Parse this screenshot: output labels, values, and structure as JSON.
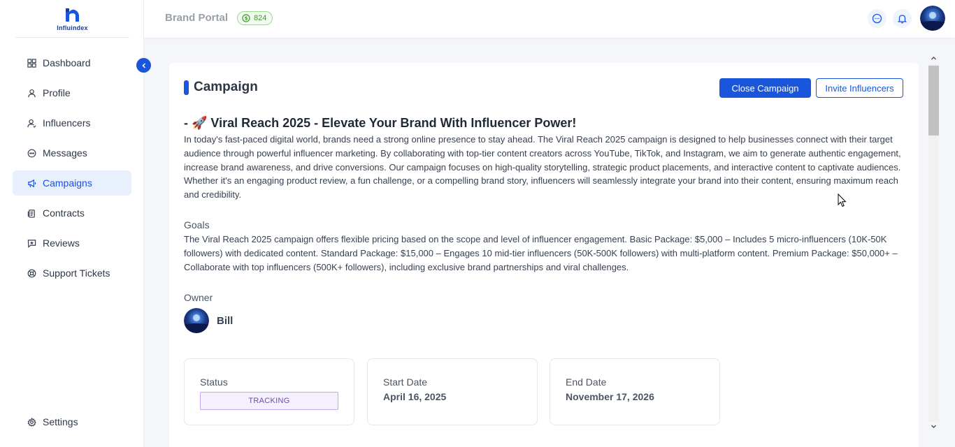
{
  "brand": {
    "logo_text": "Influindex"
  },
  "sidebar": {
    "items": [
      {
        "label": "Dashboard",
        "icon": "grid-icon",
        "active": false
      },
      {
        "label": "Profile",
        "icon": "user-icon",
        "active": false
      },
      {
        "label": "Influencers",
        "icon": "user-check-icon",
        "active": false
      },
      {
        "label": "Messages",
        "icon": "message-icon",
        "active": false
      },
      {
        "label": "Campaigns",
        "icon": "megaphone-icon",
        "active": true
      },
      {
        "label": "Contracts",
        "icon": "document-icon",
        "active": false
      },
      {
        "label": "Reviews",
        "icon": "review-icon",
        "active": false
      },
      {
        "label": "Support Tickets",
        "icon": "support-icon",
        "active": false
      }
    ],
    "settings_label": "Settings"
  },
  "header": {
    "title": "Brand Portal",
    "credits": "824"
  },
  "campaign": {
    "section_title": "Campaign",
    "close_button": "Close Campaign",
    "invite_button": "Invite Influencers",
    "heading": "- 🚀 Viral Reach 2025 - Elevate Your Brand With Influencer Power!",
    "description": "In today's fast-paced digital world, brands need a strong online presence to stay ahead. The Viral Reach 2025 campaign is designed to help businesses connect with their target audience through powerful influencer marketing. By collaborating with top-tier content creators across YouTube, TikTok, and Instagram, we aim to generate authentic engagement, increase brand awareness, and drive conversions. Our campaign focuses on high-quality storytelling, strategic product placements, and interactive content to captivate audiences. Whether it's an engaging product review, a fun challenge, or a compelling brand story, influencers will seamlessly integrate your brand into their content, ensuring maximum reach and credibility.",
    "goals_label": "Goals",
    "goals_text": "The Viral Reach 2025 campaign offers flexible pricing based on the scope and level of influencer engagement. Basic Package: $5,000 – Includes 5 micro-influencers (10K-50K followers) with dedicated content. Standard Package: $15,000 – Engages 10 mid-tier influencers (50K-500K followers) with multi-platform content. Premium Package: $50,000+ – Collaborate with top influencers (500K+ followers), including exclusive brand partnerships and viral challenges.",
    "owner_label": "Owner",
    "owner_name": "Bill",
    "status_label": "Status",
    "status_value": "TRACKING",
    "start_label": "Start Date",
    "start_value": "April 16, 2025",
    "end_label": "End Date",
    "end_value": "November 17, 2026"
  },
  "colors": {
    "accent": "#1a56db",
    "active_nav_bg": "#e8f0fe",
    "status_bg": "#f5effe",
    "status_border": "#c4a5f0",
    "credits_green": "#3f9a2a"
  }
}
